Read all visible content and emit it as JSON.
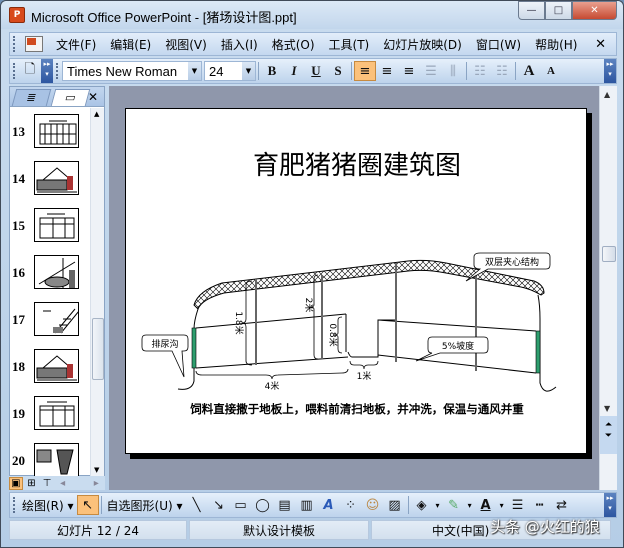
{
  "window": {
    "title": "Microsoft Office PowerPoint - [猪场设计图.ppt]",
    "app_icon": "powerpoint-icon",
    "controls": {
      "minimize": "—",
      "maximize": "□",
      "close": "✕"
    }
  },
  "menubar": {
    "items": [
      {
        "label": "文件(F)"
      },
      {
        "label": "编辑(E)"
      },
      {
        "label": "视图(V)"
      },
      {
        "label": "插入(I)"
      },
      {
        "label": "格式(O)"
      },
      {
        "label": "工具(T)"
      },
      {
        "label": "幻灯片放映(D)"
      },
      {
        "label": "窗口(W)"
      },
      {
        "label": "帮助(H)"
      }
    ],
    "close": "✕"
  },
  "toolbar": {
    "font_name": "Times New Roman",
    "font_size": "24",
    "bold": "B",
    "italic": "I",
    "underline": "U",
    "shadow": "S",
    "align_left": "≡",
    "align_center": "≡",
    "align_right": "≡",
    "grow_font": "A",
    "shrink_font": "A",
    "active_alignment": "left"
  },
  "side_panel": {
    "tabs": [
      {
        "icon": "outline-icon",
        "glyph": "≣"
      },
      {
        "icon": "slides-icon",
        "glyph": "▭"
      }
    ],
    "close": "✕",
    "slides": [
      {
        "num": "13"
      },
      {
        "num": "14"
      },
      {
        "num": "15"
      },
      {
        "num": "16"
      },
      {
        "num": "17"
      },
      {
        "num": "18"
      },
      {
        "num": "19"
      },
      {
        "num": "20"
      }
    ]
  },
  "slide": {
    "title": "育肥猪猪圈建筑图",
    "labels": {
      "double_layer": "双层夹心结构",
      "urine_ditch": "排尿沟",
      "slope": "5%坡度",
      "dim_4m": "4米",
      "dim_1m": "1米",
      "dim_1_8m": "1.8米",
      "dim_2m": "2米",
      "dim_0_8m": "0.8米"
    },
    "caption": "饲料直接撒于地板上，喂料前清扫地板，并冲洗，保温与通风并重"
  },
  "drawbar": {
    "draw_menu": "绘图(R) ▾",
    "autoshapes": "自选图形(U) ▾"
  },
  "statusbar": {
    "slide_info": "幻灯片 12 / 24",
    "template": "默认设计模板",
    "language": "中文(中国)"
  },
  "watermark": "头条 @火红的狼",
  "colors": {
    "accent_active": "#fbc17b",
    "wall_green": "#2e9e6e"
  }
}
